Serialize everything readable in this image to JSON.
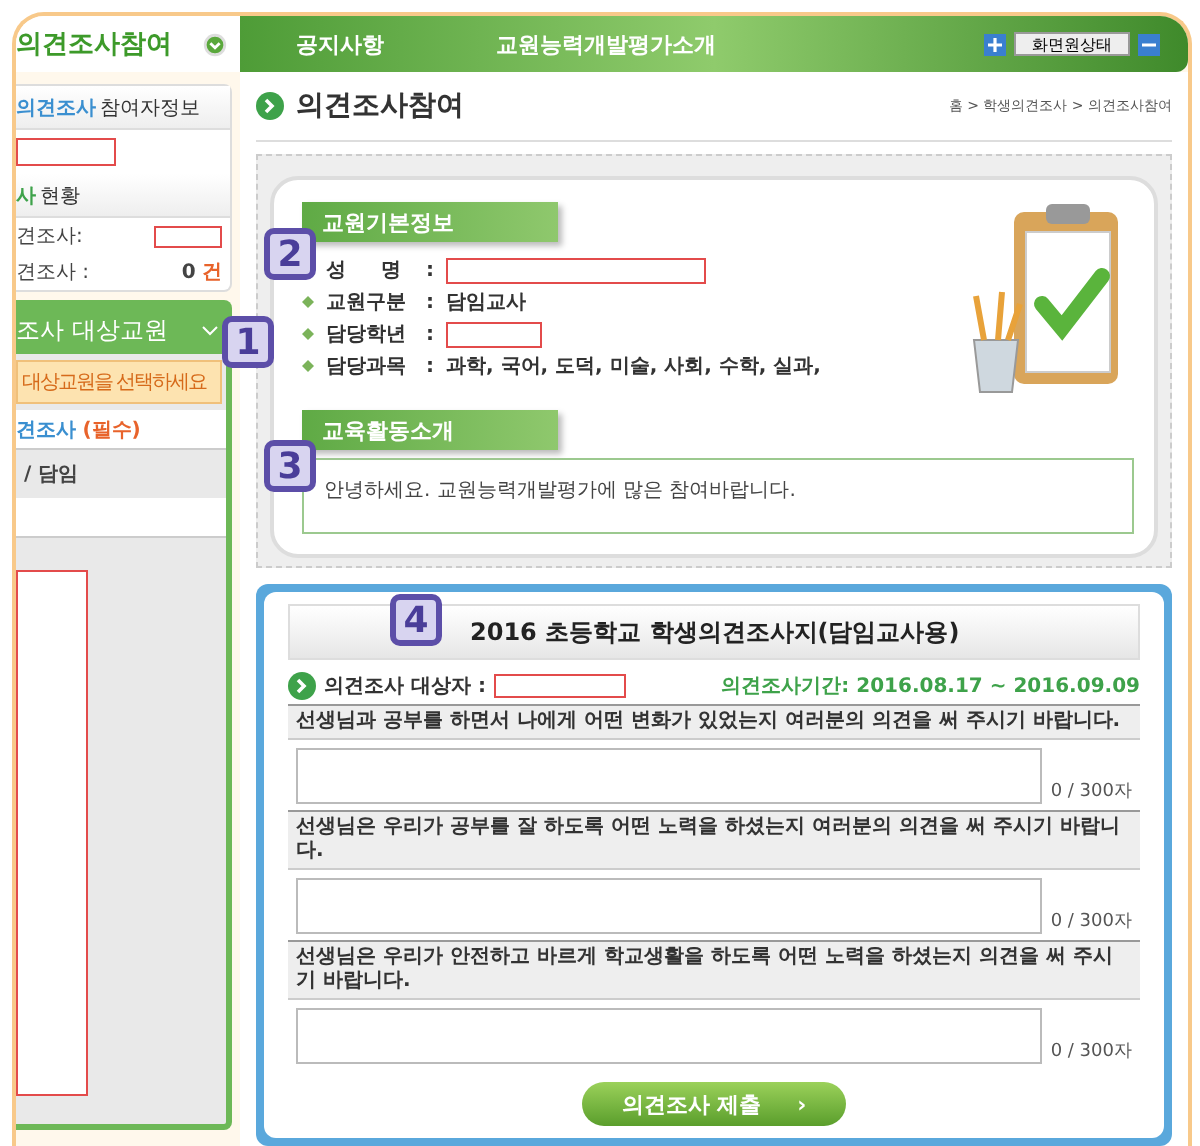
{
  "top_tab": {
    "title": "의견조사참여"
  },
  "nav": {
    "items": [
      "공지사항",
      "교원능력개발평가소개"
    ],
    "reset_button": "화면원상태"
  },
  "sidebar": {
    "participant_info": {
      "highlight": "의견조사",
      "title": "참여자정보"
    },
    "status": {
      "highlight": "사",
      "title": "현황",
      "rows": [
        {
          "kind": "field",
          "label": "견조사:"
        },
        {
          "kind": "count",
          "label": "견조사 :",
          "count": "0",
          "unit": "건"
        }
      ]
    },
    "target": {
      "title": "조사 대상교원",
      "notice": "대상교원을 선택하세요",
      "survey_label": "견조사",
      "required": "(필수)",
      "column_header": "/ 담임"
    }
  },
  "page": {
    "title": "의견조사참여",
    "breadcrumb": "홈 > 학생의견조사 > 의견조사참여"
  },
  "teacher_info": {
    "title": "교원기본정보",
    "colon": ":",
    "fields": [
      {
        "kind": "field",
        "label": "성     명"
      },
      {
        "kind": "text",
        "label": "교원구분",
        "value": "담임교사"
      },
      {
        "kind": "field",
        "label": "담당학년"
      },
      {
        "kind": "text",
        "label": "담당과목",
        "value": "과학, 국어, 도덕, 미술, 사회, 수학, 실과,"
      }
    ]
  },
  "activity": {
    "title": "교육활동소개",
    "text": "안녕하세요. 교원능력개발평가에 많은 참여바랍니다."
  },
  "survey": {
    "title": "2016 초등학교 학생의견조사지(담임교사용)",
    "target_label": "의견조사 대상자 :",
    "period": "의견조사기간: 2016.08.17 ~ 2016.09.09",
    "questions": [
      {
        "text": "선생님과 공부를 하면서 나에게 어떤 변화가 있었는지 여러분의 의견을 써 주시기 바랍니다.",
        "counter": "0 / 300자"
      },
      {
        "text": "선생님은 우리가 공부를 잘 하도록 어떤 노력을 하셨는지 여러분의 의견을 써 주시기 바랍니다.",
        "counter": "0 / 300자"
      },
      {
        "text": "선생님은 우리가 안전하고 바르게 학교생활을 하도록 어떤 노력을 하셨는지 의견을 써 주시기 바랍니다.",
        "counter": "0 / 300자"
      }
    ],
    "submit": "의견조사 제출",
    "submit_arrow": "›"
  },
  "callouts": [
    "1",
    "2",
    "3",
    "4"
  ]
}
